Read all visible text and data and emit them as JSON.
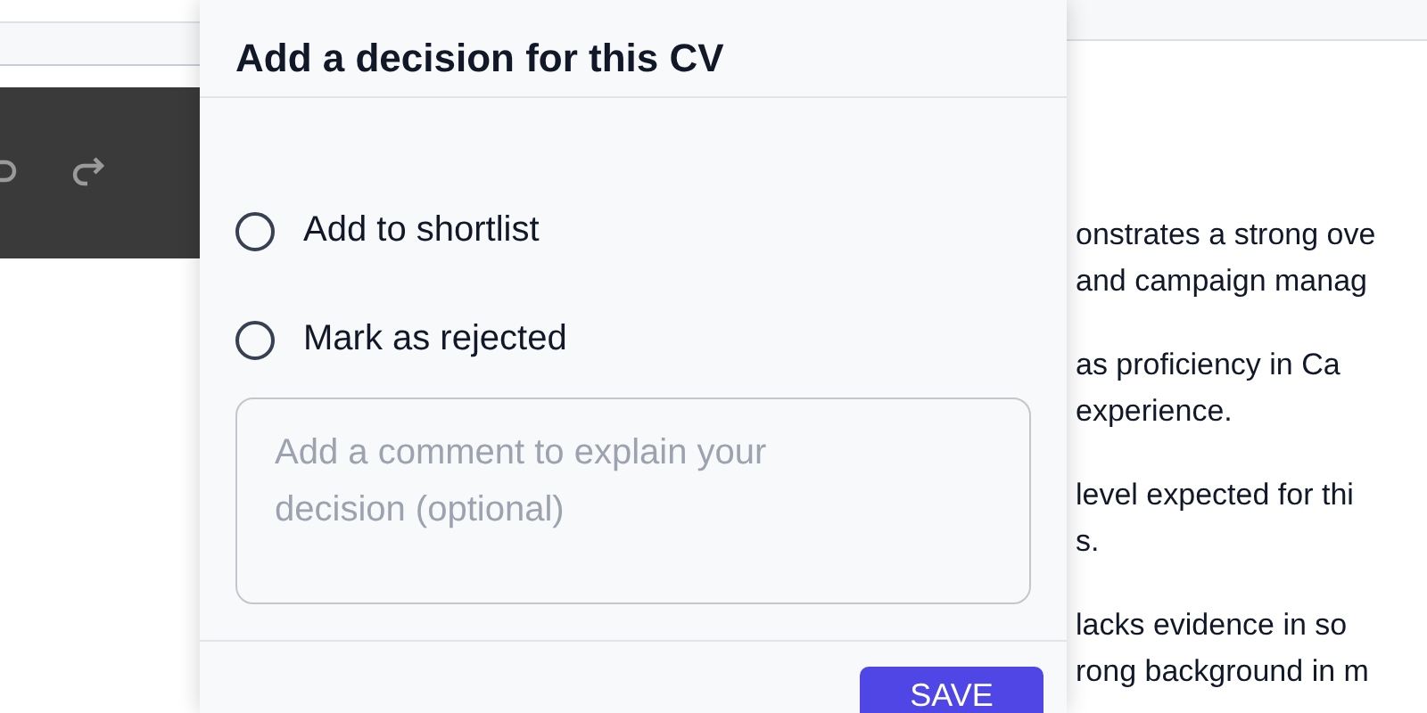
{
  "dialog": {
    "title": "Add a decision for this CV",
    "options": [
      {
        "label": "Add to shortlist",
        "selected": false
      },
      {
        "label": "Mark as rejected",
        "selected": false
      }
    ],
    "comment": {
      "placeholder": "Add a comment to explain your decision (optional)"
    },
    "save_button": "SAVE"
  },
  "background_document": {
    "paragraphs": [
      [
        "onstrates a strong ove",
        "and campaign manag"
      ],
      [
        "as proficiency in Ca",
        "experience."
      ],
      [
        "level expected for thi",
        "s."
      ],
      [
        "lacks evidence in so",
        "rong background in m"
      ]
    ]
  }
}
